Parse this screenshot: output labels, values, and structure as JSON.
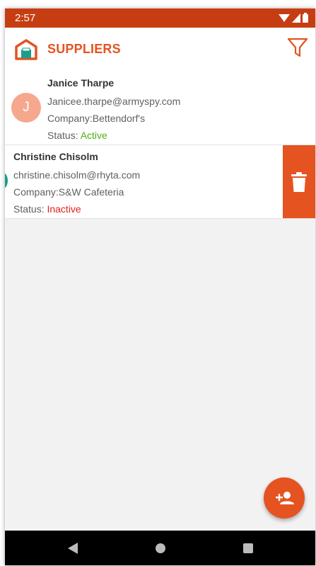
{
  "status_bar": {
    "time": "2:57"
  },
  "app_bar": {
    "title": "SUPPLIERS"
  },
  "suppliers": [
    {
      "avatar_initial": "J",
      "name": "Janice Tharpe",
      "email": "Janicee.tharpe@armyspy.com",
      "company": "Company:Bettendorf's",
      "status_label": "Status: ",
      "status": "Active"
    },
    {
      "name": "Christine Chisolm",
      "email": "christine.chisolm@rhyta.com",
      "company": "Company:S&W Cafeteria",
      "status_label": "Status: ",
      "status": "Inactive"
    }
  ],
  "colors": {
    "status_bar": "#c63d12",
    "accent": "#e55321",
    "active": "#4caf12",
    "inactive": "#e82020"
  },
  "icons": {
    "logo": "warehouse-logo-icon",
    "filter": "filter-icon",
    "delete": "trash-icon",
    "fab": "add-person-icon"
  }
}
